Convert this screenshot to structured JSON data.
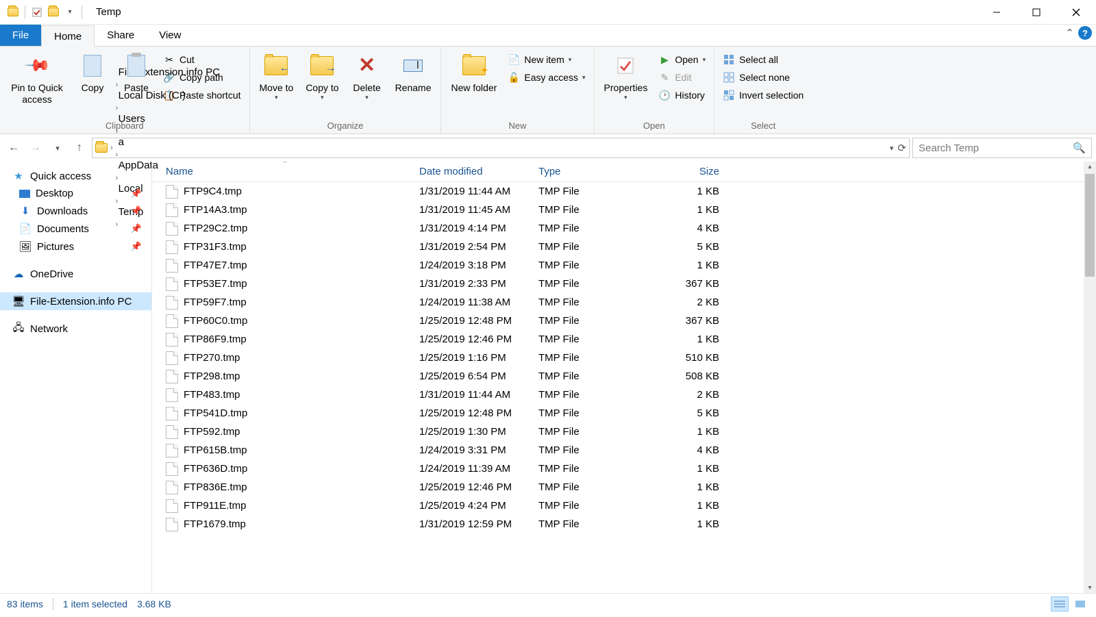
{
  "window": {
    "title": "Temp"
  },
  "tabs": {
    "file": "File",
    "home": "Home",
    "share": "Share",
    "view": "View"
  },
  "ribbon": {
    "clipboard": {
      "label": "Clipboard",
      "pin": "Pin to Quick access",
      "copy": "Copy",
      "paste": "Paste",
      "cut": "Cut",
      "copypath": "Copy path",
      "pasteshort": "Paste shortcut"
    },
    "organize": {
      "label": "Organize",
      "moveto": "Move to",
      "copyto": "Copy to",
      "delete": "Delete",
      "rename": "Rename"
    },
    "new": {
      "label": "New",
      "newfolder": "New folder",
      "newitem": "New item",
      "easyaccess": "Easy access"
    },
    "open": {
      "label": "Open",
      "properties": "Properties",
      "open": "Open",
      "edit": "Edit",
      "history": "History"
    },
    "select": {
      "label": "Select",
      "all": "Select all",
      "none": "Select none",
      "invert": "Invert selection"
    }
  },
  "breadcrumb": [
    "File-Extension.info PC",
    "Local Disk (C:)",
    "Users",
    "a",
    "AppData",
    "Local",
    "Temp"
  ],
  "search_placeholder": "Search Temp",
  "nav": {
    "quick": "Quick access",
    "desktop": "Desktop",
    "downloads": "Downloads",
    "documents": "Documents",
    "pictures": "Pictures",
    "onedrive": "OneDrive",
    "thispc": "File-Extension.info PC",
    "network": "Network"
  },
  "columns": {
    "name": "Name",
    "date": "Date modified",
    "type": "Type",
    "size": "Size"
  },
  "files": [
    {
      "name": "FTP9C4.tmp",
      "date": "1/31/2019 11:44 AM",
      "type": "TMP File",
      "size": "1 KB"
    },
    {
      "name": "FTP14A3.tmp",
      "date": "1/31/2019 11:45 AM",
      "type": "TMP File",
      "size": "1 KB"
    },
    {
      "name": "FTP29C2.tmp",
      "date": "1/31/2019 4:14 PM",
      "type": "TMP File",
      "size": "4 KB"
    },
    {
      "name": "FTP31F3.tmp",
      "date": "1/31/2019 2:54 PM",
      "type": "TMP File",
      "size": "5 KB"
    },
    {
      "name": "FTP47E7.tmp",
      "date": "1/24/2019 3:18 PM",
      "type": "TMP File",
      "size": "1 KB"
    },
    {
      "name": "FTP53E7.tmp",
      "date": "1/31/2019 2:33 PM",
      "type": "TMP File",
      "size": "367 KB"
    },
    {
      "name": "FTP59F7.tmp",
      "date": "1/24/2019 11:38 AM",
      "type": "TMP File",
      "size": "2 KB"
    },
    {
      "name": "FTP60C0.tmp",
      "date": "1/25/2019 12:48 PM",
      "type": "TMP File",
      "size": "367 KB"
    },
    {
      "name": "FTP86F9.tmp",
      "date": "1/25/2019 12:46 PM",
      "type": "TMP File",
      "size": "1 KB"
    },
    {
      "name": "FTP270.tmp",
      "date": "1/25/2019 1:16 PM",
      "type": "TMP File",
      "size": "510 KB"
    },
    {
      "name": "FTP298.tmp",
      "date": "1/25/2019 6:54 PM",
      "type": "TMP File",
      "size": "508 KB"
    },
    {
      "name": "FTP483.tmp",
      "date": "1/31/2019 11:44 AM",
      "type": "TMP File",
      "size": "2 KB"
    },
    {
      "name": "FTP541D.tmp",
      "date": "1/25/2019 12:48 PM",
      "type": "TMP File",
      "size": "5 KB"
    },
    {
      "name": "FTP592.tmp",
      "date": "1/25/2019 1:30 PM",
      "type": "TMP File",
      "size": "1 KB"
    },
    {
      "name": "FTP615B.tmp",
      "date": "1/24/2019 3:31 PM",
      "type": "TMP File",
      "size": "4 KB"
    },
    {
      "name": "FTP636D.tmp",
      "date": "1/24/2019 11:39 AM",
      "type": "TMP File",
      "size": "1 KB"
    },
    {
      "name": "FTP836E.tmp",
      "date": "1/25/2019 12:46 PM",
      "type": "TMP File",
      "size": "1 KB"
    },
    {
      "name": "FTP911E.tmp",
      "date": "1/25/2019 4:24 PM",
      "type": "TMP File",
      "size": "1 KB"
    },
    {
      "name": "FTP1679.tmp",
      "date": "1/31/2019 12:59 PM",
      "type": "TMP File",
      "size": "1 KB"
    }
  ],
  "status": {
    "items": "83 items",
    "selection": "1 item selected",
    "size": "3.68 KB"
  }
}
